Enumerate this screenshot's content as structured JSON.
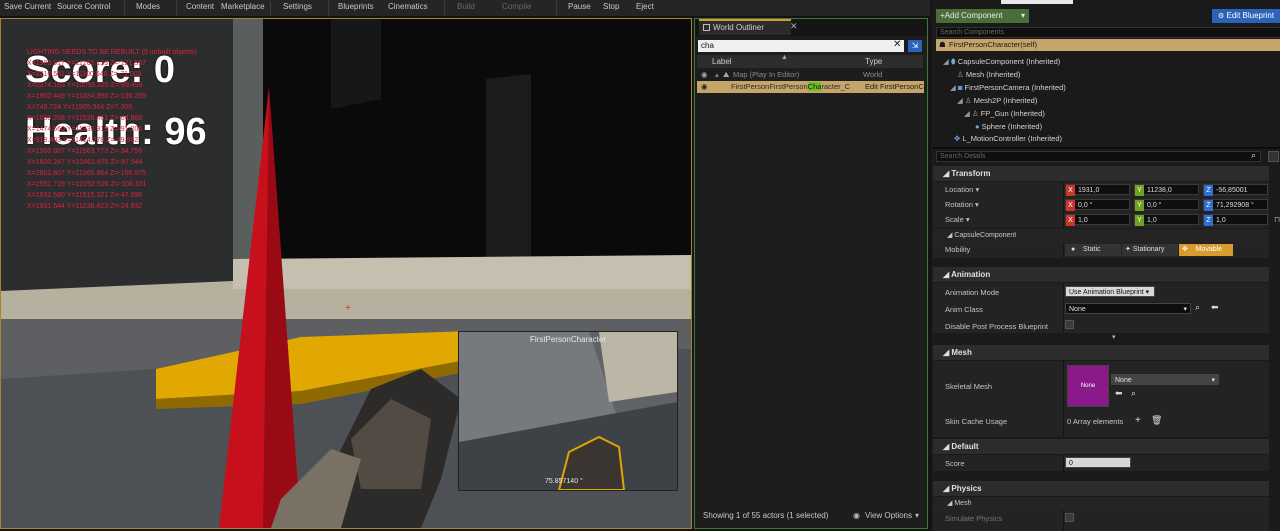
{
  "toolbar": {
    "save_current": "Save Current",
    "source_control": "Source Control",
    "modes": "Modes",
    "content": "Content",
    "marketplace": "Marketplace",
    "settings": "Settings",
    "blueprints": "Blueprints",
    "cinematics": "Cinematics",
    "build": "Build",
    "compile": "Compile",
    "pause": "Pause",
    "stop": "Stop",
    "eject": "Eject"
  },
  "viewport": {
    "hud": {
      "score": "Score: 0",
      "health": "Health: 96"
    },
    "debug_lines": [
      "LIGHTING NEEDS TO BE REBUILT (5 unbuilt objects)",
      "X=1903.917 Y=11265.133 Z=-121.557",
      "X=2216.551 Y=11100.540 Z=-71.003",
      "X=2374.163 Y=10255.325 Z=-89.499",
      "X=1902.449 Y=11034.390 Z=-136.209",
      "X=749.724 Y=11905.964 Z=7.309",
      "X=1080.268 Y=11539.461 Z=-64.668",
      "X=1474.560 Y=11330.919 Z=-91.206",
      "X=918.403 Y=11414.278 Z=-49.882",
      "X=1500.887 Y=11563.773 Z=-34.756",
      "X=1600.247 Y=10461.676 Z=-97.544",
      "X=2602.807 Y=11365.964 Z=-156.975",
      "X=2551.719 Y=10252.526 Z=-108.101",
      "X=1932.580 Y=11515.321 Z=-47.996",
      "X=1931.544 Y=11238.823 Z=-24.932"
    ],
    "pip": {
      "title": "FirstPersonCharacter",
      "stat": "75.857140 °"
    }
  },
  "outliner": {
    "tab_title": "World Outliner",
    "search_value": "cha",
    "col_label": "Label",
    "col_type": "Type",
    "rows": [
      {
        "label": "Map (Play In Editor)",
        "type": "World"
      },
      {
        "label_prefix": "FirstPersonFirstPerson",
        "label_highlight": "Cha",
        "label_suffix": "racter_C",
        "type": "Edit FirstPersonC"
      }
    ],
    "footer": "Showing 1 of 55 actors (1 selected)",
    "view_options": "View Options"
  },
  "details": {
    "add_component": "+Add Component",
    "edit_blueprint": "Edit Blueprint",
    "search_components_placeholder": "Search Components",
    "self_row": "FirstPersonCharacter(self)",
    "components": [
      "CapsuleComponent (Inherited)",
      "Mesh (Inherited)",
      "FirstPersonCamera (Inherited)",
      "Mesh2P (Inherited)",
      "FP_Gun (Inherited)",
      "Sphere (Inherited)",
      "L_MotionController (Inherited)"
    ],
    "search_details_placeholder": "Search Details",
    "transform": {
      "title": "Transform",
      "location_label": "Location",
      "rotation_label": "Rotation",
      "scale_label": "Scale",
      "location": [
        "1931,0",
        "11238,0",
        "-56,85001"
      ],
      "rotation": [
        "0,0 °",
        "0,0 °",
        "71,292908 °"
      ],
      "scale": [
        "1,0",
        "1,0",
        "1,0"
      ]
    },
    "capsule": {
      "title": "CapsuleComponent",
      "mobility_label": "Mobility",
      "static": "Static",
      "stationary": "Stationary",
      "movable": "Movable"
    },
    "animation": {
      "title": "Animation",
      "mode_label": "Animation Mode",
      "mode_value": "Use Animation Blueprint",
      "class_label": "Anim Class",
      "class_value": "None",
      "disable_pp_label": "Disable Post Process Blueprint"
    },
    "mesh": {
      "title": "Mesh",
      "skeletal_label": "Skeletal Mesh",
      "skeletal_thumb": "None",
      "skeletal_value": "None",
      "skin_cache_label": "Skin Cache Usage",
      "skin_cache_value": "0 Array elements"
    },
    "default": {
      "title": "Default",
      "score_label": "Score",
      "score_value": "0"
    },
    "physics": {
      "title": "Physics",
      "mesh_sub": "Mesh",
      "simulate_label": "Simulate Physics"
    }
  },
  "colors": {
    "accent": "#d79b2e",
    "edit_blueprint_bg": "#2a63b8",
    "add_component_bg": "#4a6e3a",
    "axis_x": "#c8352b",
    "axis_y": "#6ea321",
    "axis_z": "#2f6fcf",
    "debug_text": "#e0213b",
    "selected_row": "#c5a56a"
  }
}
